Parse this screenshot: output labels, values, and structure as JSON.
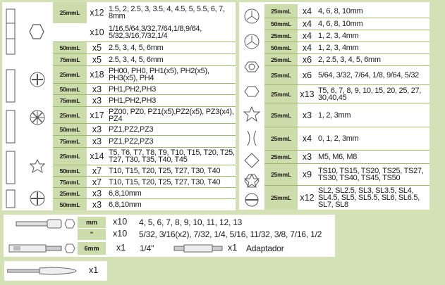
{
  "left_table": [
    {
      "size": "25mmL",
      "qty": "x12",
      "desc": "1.5, 2, 2.5, 3, 3.5, 4, 4.5, 5, 5.5, 6, 7, 8mm"
    },
    {
      "size": "",
      "qty": "x10",
      "desc": "1/16,5/64,3/32,7/64,1/8,9/64, 5/32,3/16,7/32,1/4"
    },
    {
      "size": "50mmL",
      "qty": "x5",
      "desc": "2.5, 3, 4, 5, 6mm"
    },
    {
      "size": "75mmL",
      "qty": "x5",
      "desc": "2.5, 3, 4, 5, 6mm"
    },
    {
      "size": "25mmL",
      "qty": "x18",
      "desc": "PH00, PH0, PH1(x5), PH2(x5), PH3(x5), PH4"
    },
    {
      "size": "50mmL",
      "qty": "x3",
      "desc": "PH1,PH2,PH3"
    },
    {
      "size": "75mmL",
      "qty": "x3",
      "desc": "PH1,PH2,PH3"
    },
    {
      "size": "25mmL",
      "qty": "x17",
      "desc": "PZ00, PZ0, PZ1(x5),PZ2(x5), PZ3(x4), PZ4"
    },
    {
      "size": "50mmL",
      "qty": "x3",
      "desc": "PZ1,PZ2,PZ3"
    },
    {
      "size": "75mmL",
      "qty": "x3",
      "desc": "PZ1,PZ2,PZ3"
    },
    {
      "size": "25mmL",
      "qty": "x14",
      "desc": "T5, T6, T7, T8, T9, T10, T15, T20, T25, T27, T30, T35, T40, T45"
    },
    {
      "size": "50mmL",
      "qty": "x7",
      "desc": "T10, T15, T20, T25, T27, T30, T40"
    },
    {
      "size": "75mmL",
      "qty": "x7",
      "desc": "T10, T15, T20, T25, T27, T30, T40"
    },
    {
      "size": "25mmL",
      "qty": "x3",
      "desc": "6,8,10mm"
    },
    {
      "size": "50mmL",
      "qty": "x3",
      "desc": "6,8,10mm"
    }
  ],
  "right_table": [
    {
      "size": "25mmL",
      "qty": "x4",
      "desc": "4, 6, 8, 10mm"
    },
    {
      "size": "50mmL",
      "qty": "x4",
      "desc": "4, 6, 8, 10mm"
    },
    {
      "size": "25mmL",
      "qty": "x4",
      "desc": "1, 2, 3, 4mm"
    },
    {
      "size": "50mmL",
      "qty": "x4",
      "desc": "1, 2, 3, 4mm"
    },
    {
      "size": "25mmL",
      "qty": "x6",
      "desc": "2, 2.5, 3, 4, 5, 6mm"
    },
    {
      "size": "25mmL",
      "qty": "x6",
      "desc": "5/64, 3/32, 7/64, 1/8, 9/64, 5/32"
    },
    {
      "size": "25mmL",
      "qty": "x13",
      "desc": "T5, 6, 7, 8, 9, 10, 15, 20, 25, 27, 30,40,45"
    },
    {
      "size": "25mmL",
      "qty": "x3",
      "desc": "1, 2, 3mm"
    },
    {
      "size": "25mmL",
      "qty": "x4",
      "desc": "0, 1, 2, 3mm"
    },
    {
      "size": "25mmL",
      "qty": "x3",
      "desc": "M5, M6, M8"
    },
    {
      "size": "25mmL",
      "qty": "x9",
      "desc": "TS10, TS15, TS20, TS25, TS27, TS30, TS40, TS45, TS50"
    },
    {
      "size": "25mmL",
      "qty": "x12",
      "desc": "SL2, SL2.5, SL3, SL3.5, SL4, SL4.5, SL5, SL5.5, SL6, SL6.5, SL7, SL8"
    }
  ],
  "sockets": [
    {
      "size": "mm",
      "qty": "x10",
      "desc": "4, 5, 6, 7, 8, 9, 10, 11, 12, 13"
    },
    {
      "size": "\"",
      "qty": "x10",
      "desc": "5/32, 3/16(x2), 7/32, 1/4, 5/16, 11/32, 3/8, 7/16, 1/2"
    }
  ],
  "adapter_row": {
    "size": "6mm",
    "qty": "x1",
    "desc": "1/4\"",
    "adapter_qty": "x1",
    "adapter_label": "Adaptador"
  },
  "screwdriver": {
    "qty": "x1"
  },
  "colors": {
    "background": "#d3e1b4",
    "size_cell": "#ccdcab",
    "separator": "#9dbb6e"
  }
}
